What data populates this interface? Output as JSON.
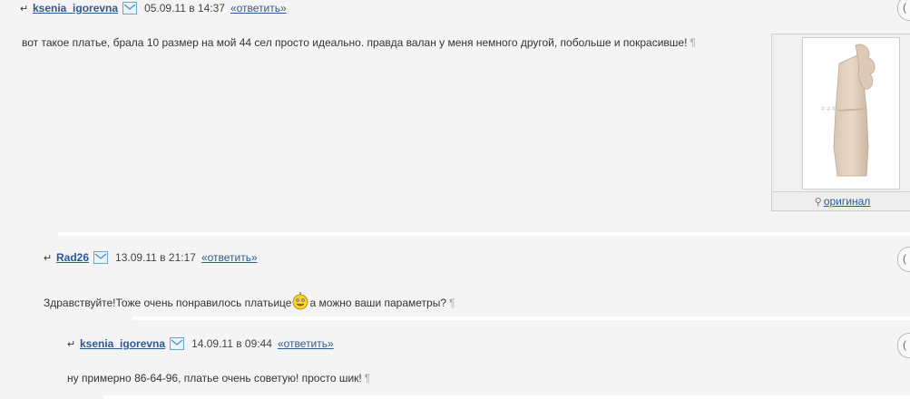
{
  "comments": [
    {
      "user": "ksenia_igorevna",
      "date": "05.09.11 в 14:37",
      "reply_label": "«ответить»",
      "text": "вот такое платье, брала 10 размер на мой 44 сел просто идеально. правда валан у меня немного другой, побольше и покрасивше!",
      "pilcrow": "¶",
      "image_link": "оригинал"
    },
    {
      "user": "Rad26",
      "date": "13.09.11 в 21:17",
      "reply_label": "«ответить»",
      "text_before": "Здравствуйте!Тоже очень понравилось платьице",
      "text_after": "а можно ваши параметры?",
      "pilcrow": "¶"
    },
    {
      "user": "ksenia_igorevna",
      "date": "14.09.11 в 09:44",
      "reply_label": "«ответить»",
      "text": "ну примерно 86-64-96, платье очень советую! просто шик!",
      "pilcrow": "¶"
    }
  ],
  "side_button_glyph": "(",
  "arrow_glyph": "↵",
  "icons": {
    "mail": "mail-icon",
    "smiley": "smiley-icon",
    "magnifier": "magnifier-icon"
  },
  "colors": {
    "background": "#f4f4f4",
    "link": "#2b5a9b",
    "text": "#333333"
  }
}
